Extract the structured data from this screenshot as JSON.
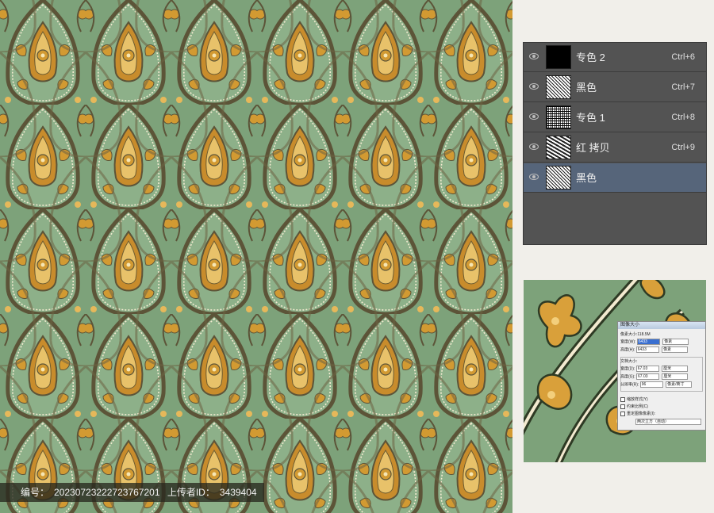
{
  "watermark": {
    "label_id": "编号：",
    "id": "20230723222723767201",
    "label_uploader": "上传者ID：",
    "uploader_id": "3439404"
  },
  "layers": [
    {
      "name": "专色 2",
      "shortcut": "Ctrl+6",
      "thumb": "black",
      "selected": false
    },
    {
      "name": "黑色",
      "shortcut": "Ctrl+7",
      "thumb": "noise",
      "selected": false
    },
    {
      "name": "专色 1",
      "shortcut": "Ctrl+8",
      "thumb": "noise2",
      "selected": false
    },
    {
      "name": "红 拷贝",
      "shortcut": "Ctrl+9",
      "thumb": "noise3",
      "selected": false
    },
    {
      "name": "黑色",
      "shortcut": "",
      "thumb": "noise",
      "selected": true
    }
  ],
  "dialog": {
    "title": "图像大小",
    "pixel_size": "像素大小:118.5M",
    "width_label": "宽度(W):",
    "width_value": "6433",
    "height_label": "高度(H):",
    "height_value": "6433",
    "pixel_unit": "像素",
    "doc_size": "文档大小:",
    "doc_width_label": "宽度(D):",
    "doc_width_value": "67.03",
    "doc_height_label": "高度(G):",
    "doc_height_value": "67.03",
    "unit_cm": "厘米",
    "res_label": "分辨率(R):",
    "res_value": "96",
    "res_unit": "像素/英寸",
    "opt1": "缩放样式(Y)",
    "opt2": "约束比例(C)",
    "opt3": "重定图像像素(I):",
    "resample": "两次立方（自动）"
  },
  "colors": {
    "pattern_green": "#7da27a",
    "pattern_gold": "#d29a32",
    "pattern_line": "#5c5438",
    "panel_bg": "#535353",
    "panel_selected": "#56657a"
  }
}
